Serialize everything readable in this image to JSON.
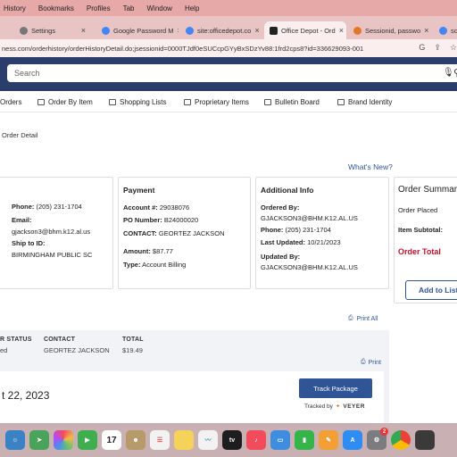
{
  "menubar": [
    "History",
    "Bookmarks",
    "Profiles",
    "Tab",
    "Window",
    "Help"
  ],
  "tabs": [
    {
      "label": "Settings",
      "favicon": "gear-icon"
    },
    {
      "label": "Google Password M",
      "favicon": "google-icon"
    },
    {
      "label": "site:officedepot.co",
      "favicon": "google-icon"
    },
    {
      "label": "Office Depot - Ord",
      "favicon": "officedepot-icon",
      "active": true
    },
    {
      "label": "Sessionid, passwo",
      "favicon": "stackoverflow-icon"
    },
    {
      "label": "sc",
      "favicon": "google-icon"
    }
  ],
  "url": "ness.com/orderhistory/orderHistoryDetail.do;jsessionid=0000TJdf0eSUCcpGYyBxSDzYv88:1frd2cps8?id=336629093-001",
  "search": {
    "placeholder": "Search"
  },
  "nav": [
    "Orders",
    "Order By Item",
    "Shopping Lists",
    "Proprietary Items",
    "Bulletin Board",
    "Brand Identity"
  ],
  "breadcrumb": "Order Detail",
  "whats_new": "What's New?",
  "shipping": {
    "phone_label": "Phone:",
    "phone": "(205) 231-1704",
    "email_label": "Email:",
    "email": "gjackson3@bhm.k12.al.us",
    "ship_to_label": "Ship to ID:",
    "ship_to": "BIRMINGHAM PUBLIC SC"
  },
  "payment": {
    "title": "Payment",
    "account_label": "Account #:",
    "account": "29038076",
    "po_label": "PO Number:",
    "po": "B24000020",
    "contact_label": "CONTACT:",
    "contact": "GEORTEZ JACKSON",
    "amount_label": "Amount:",
    "amount": "$87.77",
    "type_label": "Type:",
    "type": "Account Billing"
  },
  "additional": {
    "title": "Additional Info",
    "ordered_by_label": "Ordered By:",
    "ordered_by": "GJACKSON3@BHM.K12.AL.US",
    "phone_label": "Phone:",
    "phone": "(205) 231-1704",
    "last_updated_label": "Last Updated:",
    "last_updated": "10/21/2023",
    "updated_by_label": "Updated By:",
    "updated_by": "GJACKSON3@BHM.K12.AL.US"
  },
  "summary": {
    "title": "Order Summar",
    "placed": "Order Placed",
    "subtotal": "Item Subtotal:",
    "total": "Order Total"
  },
  "add_to_list": "Add to List",
  "print_all": "Print All",
  "print": "Print",
  "status_table": {
    "status_header": "R STATUS",
    "status_value": "ed",
    "contact_header": "CONTACT",
    "contact_value": "GEORTEZ JACKSON",
    "total_header": "TOTAL",
    "total_value": "$19.49"
  },
  "ship_date": "t 22, 2023",
  "track_button": "Track Package",
  "tracked_by": "Tracked by",
  "tracked_logo": "VEYER",
  "dock": [
    {
      "name": "finder",
      "color": "#3b82c4"
    },
    {
      "name": "maps",
      "color": "#4aa35a"
    },
    {
      "name": "photos",
      "color": "#e8a84c"
    },
    {
      "name": "facetime",
      "color": "#3fae4f"
    },
    {
      "name": "calendar",
      "color": "#ffffff"
    },
    {
      "name": "contacts",
      "color": "#b79a6a"
    },
    {
      "name": "reminders",
      "color": "#f2f2f2"
    },
    {
      "name": "notes",
      "color": "#f5d35a"
    },
    {
      "name": "freeform",
      "color": "#f2f2f2"
    },
    {
      "name": "tv",
      "color": "#1d1d1f"
    },
    {
      "name": "music",
      "color": "#f24b5b"
    },
    {
      "name": "keynote",
      "color": "#3f8de0"
    },
    {
      "name": "numbers",
      "color": "#35b44a"
    },
    {
      "name": "pages",
      "color": "#f29f36"
    },
    {
      "name": "app-store",
      "color": "#2f8cf2"
    },
    {
      "name": "settings",
      "color": "#7b7b80"
    },
    {
      "name": "chrome",
      "color": "#f2f2f2"
    },
    {
      "name": "screen",
      "color": "#3a3a3a"
    }
  ],
  "dock_calendar_day": "17",
  "dock_tv_label": "tv",
  "dock_settings_badge": "2"
}
